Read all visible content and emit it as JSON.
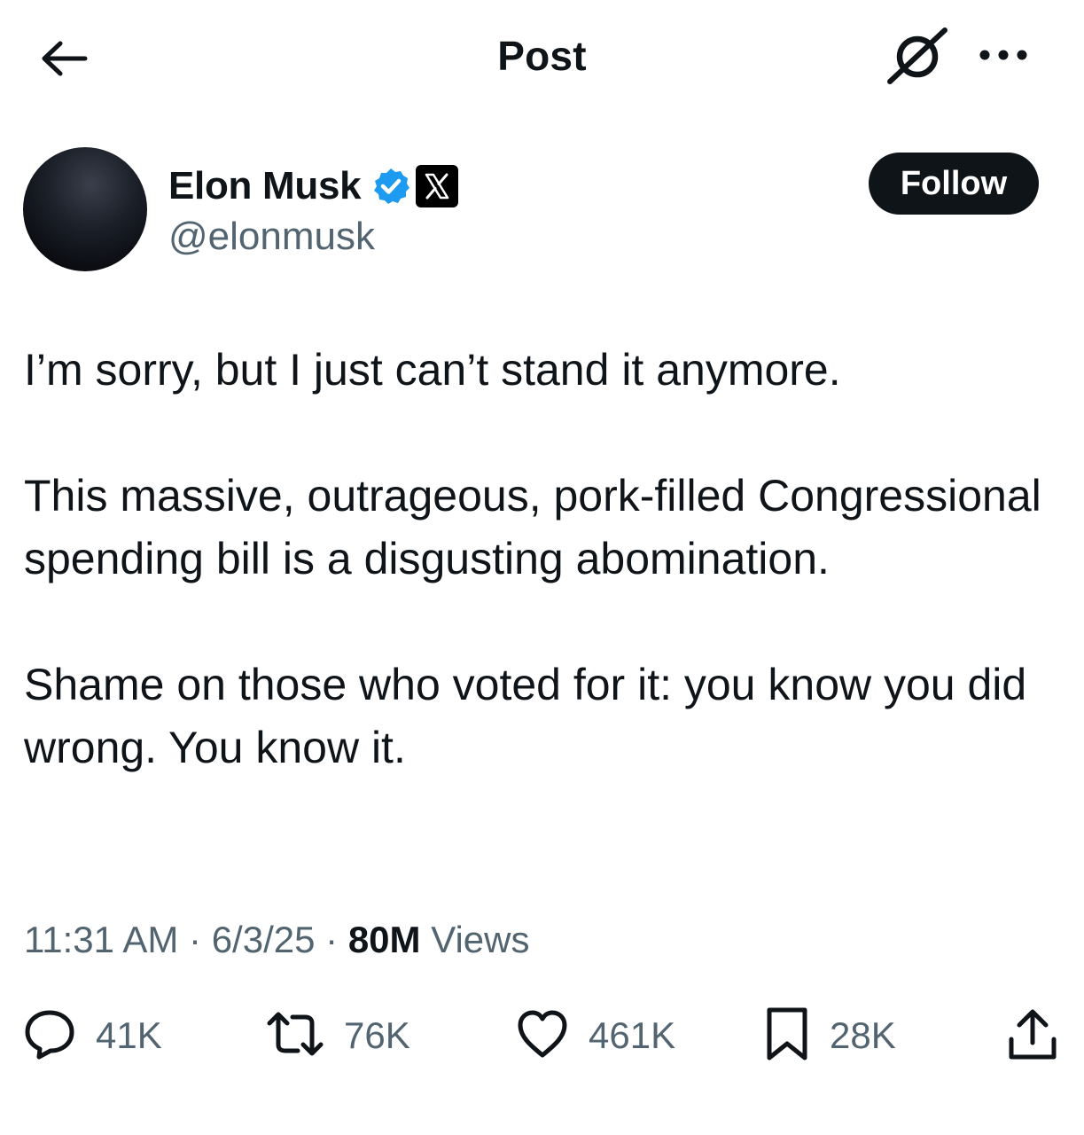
{
  "header": {
    "title": "Post",
    "back_icon": "arrow-left-icon",
    "grok_icon": "grok-icon",
    "more_icon": "more-dots-icon"
  },
  "author": {
    "display_name": "Elon Musk",
    "handle": "@elonmusk",
    "verified_icon": "verified-badge-icon",
    "affiliate_icon": "x-logo-icon",
    "follow_label": "Follow"
  },
  "post": {
    "paragraphs": [
      "I’m sorry, but I just can’t stand it anymore.",
      "This massive, outrageous, pork-filled Congressional spending bill is a disgusting abomination.",
      "Shame on those who voted for it: you know you did wrong. You know it."
    ],
    "time": "11:31 AM",
    "date": "6/3/25",
    "separator": "·",
    "views_count": "80M",
    "views_label": "Views"
  },
  "actions": {
    "replies": "41K",
    "reposts": "76K",
    "likes": "461K",
    "bookmarks": "28K"
  },
  "colors": {
    "text": "#0f1419",
    "secondary": "#536471",
    "verified": "#1d9bf0",
    "follow_bg": "#0f1419"
  }
}
